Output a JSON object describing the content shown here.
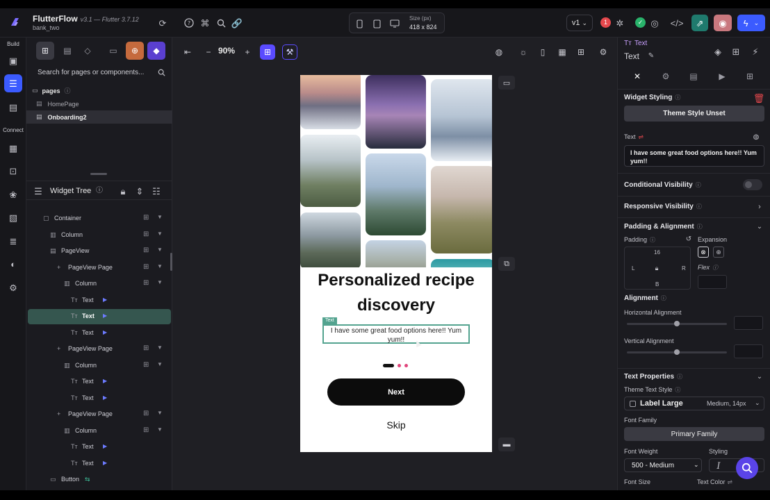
{
  "app": {
    "name": "FlutterFlow",
    "version": "v3.1 — Flutter 3.7.12",
    "project": "bank_two"
  },
  "topbar": {
    "size_label": "Size (px)",
    "size_value": "418 x 824",
    "version_selector": "v1",
    "issues_count": "1"
  },
  "rail": {
    "build_label": "Build",
    "connect_label": "Connect"
  },
  "left": {
    "search_placeholder": "Search for pages or components...",
    "pages_label": "pages",
    "pages": [
      "HomePage",
      "Onboarding2"
    ],
    "widget_tree_title": "Widget Tree",
    "tree": [
      {
        "label": "Container",
        "indent": 0
      },
      {
        "label": "Column",
        "indent": 1
      },
      {
        "label": "PageView",
        "indent": 1
      },
      {
        "label": "PageView Page",
        "indent": 2
      },
      {
        "label": "Column",
        "indent": 3
      },
      {
        "label": "Text",
        "indent": 4
      },
      {
        "label": "Text",
        "indent": 4,
        "selected": true
      },
      {
        "label": "Text",
        "indent": 4
      },
      {
        "label": "PageView Page",
        "indent": 2
      },
      {
        "label": "Column",
        "indent": 3
      },
      {
        "label": "Text",
        "indent": 4
      },
      {
        "label": "Text",
        "indent": 4
      },
      {
        "label": "PageView Page",
        "indent": 2
      },
      {
        "label": "Column",
        "indent": 3
      },
      {
        "label": "Text",
        "indent": 4
      },
      {
        "label": "Text",
        "indent": 4
      },
      {
        "label": "Button",
        "indent": 1
      }
    ]
  },
  "canvas": {
    "zoom": "90%",
    "headline": "Personalized recipe discovery",
    "subtitle": "I have some great food options here!! Yum yum!!",
    "selected_tag": "Text",
    "next_label": "Next",
    "skip_label": "Skip",
    "page_indicator": {
      "count": 3,
      "active": 0
    },
    "colors": {
      "active_dot": "#111111",
      "inactive_dot": "#e0457b",
      "selection": "#53a38f"
    }
  },
  "right": {
    "widget_type": "Text",
    "widget_name": "Text",
    "widget_styling": "Widget Styling",
    "theme_style_button": "Theme Style Unset",
    "text_label": "Text",
    "text_value": "I have some great food options here!! Yum yum!!",
    "conditional_visibility": "Conditional Visibility",
    "responsive_visibility": "Responsive Visibility",
    "padding_alignment": "Padding & Alignment",
    "padding_label": "Padding",
    "padding_top": "16",
    "padding_l": "L",
    "padding_r": "R",
    "padding_b": "B",
    "expansion_label": "Expansion",
    "flex_label": "Flex",
    "alignment_label": "Alignment",
    "horizontal_alignment": "Horizontal Alignment",
    "vertical_alignment": "Vertical Alignment",
    "horizontal_alignment_value": 0.5,
    "vertical_alignment_value": 0.5,
    "text_properties": "Text Properties",
    "theme_text_style": "Theme Text Style",
    "text_style_name": "Label Large",
    "text_style_detail": "Medium, 14px",
    "font_family_label": "Font Family",
    "font_family_value": "Primary Family",
    "font_weight_label": "Font Weight",
    "font_weight_value": "500 - Medium",
    "styling_label": "Styling",
    "font_size_label": "Font Size",
    "text_color_label": "Text Color"
  }
}
